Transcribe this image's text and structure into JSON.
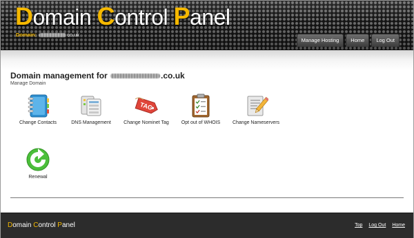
{
  "header": {
    "logo": {
      "d": "D",
      "omain": "omain ",
      "c": "C",
      "ontrol": "ontrol ",
      "p": "P",
      "anel": "anel"
    },
    "domain_label": "Domain:",
    "domain_suffix": "co.uk",
    "nav": [
      "Manage Hosting",
      "Home",
      "Log Out"
    ]
  },
  "main": {
    "title_prefix": "Domain management for",
    "title_suffix": ".co.uk",
    "subtitle": "Manage Domain",
    "tiles": [
      {
        "label": "Change Contacts",
        "icon": "address-book-icon"
      },
      {
        "label": "DNS Management",
        "icon": "dns-servers-icon"
      },
      {
        "label": "Change Nominet Tag",
        "icon": "tag-icon",
        "tag_text": "TAG"
      },
      {
        "label": "Opt out of WHOIS",
        "icon": "clipboard-checklist-icon"
      },
      {
        "label": "Change Nameservers",
        "icon": "document-edit-icon"
      },
      {
        "label": "Renewal",
        "icon": "renew-arrow-icon"
      }
    ]
  },
  "footer": {
    "logo": {
      "d": "D",
      "omain": "omain ",
      "c": "C",
      "ontrol": "ontrol ",
      "p": "P",
      "anel": "anel"
    },
    "links": [
      "Top",
      "Log Out",
      "Home"
    ]
  },
  "colors": {
    "accent": "#f5b800",
    "footer_bg": "#2c2c2c"
  }
}
